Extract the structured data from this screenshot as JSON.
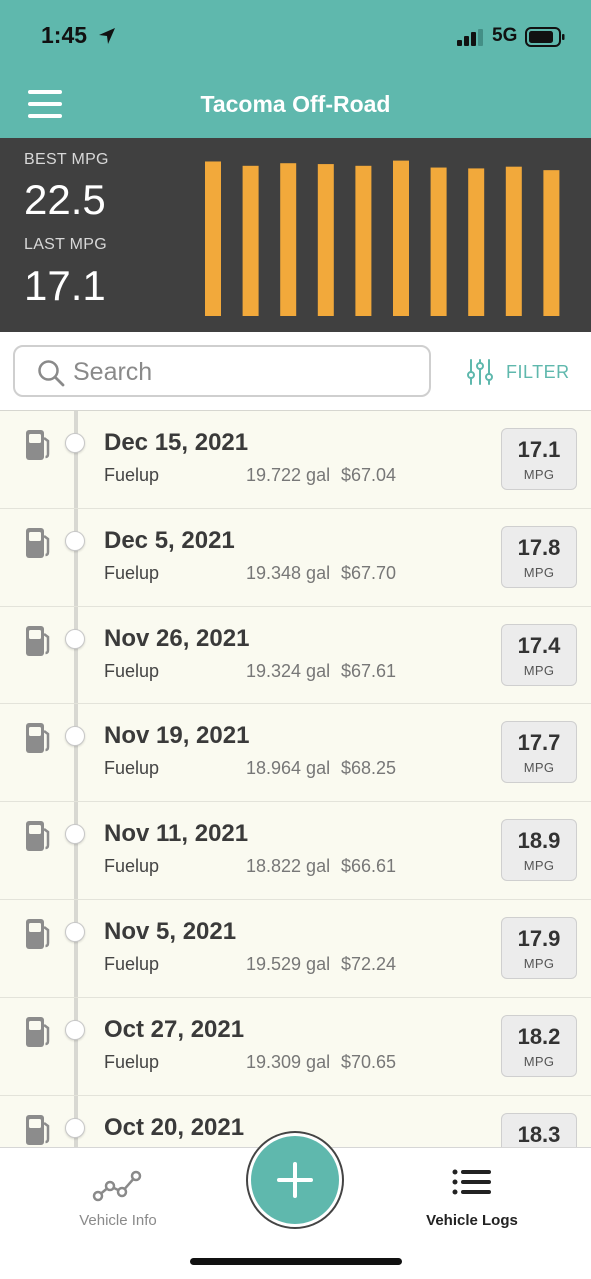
{
  "status_bar": {
    "time": "1:45",
    "network": "5G"
  },
  "header": {
    "title": "Tacoma Off-Road",
    "menu_icon": "hamburger-menu-icon"
  },
  "stats": {
    "best_label": "BEST MPG",
    "best_value": "22.5",
    "last_label": "LAST MPG",
    "last_value": "17.1",
    "bar_color": "#f2a93b"
  },
  "chart_data": {
    "type": "bar",
    "title": "",
    "values": [
      17.8,
      17.3,
      17.6,
      17.5,
      17.3,
      17.9,
      17.1,
      17.0,
      17.2,
      16.8
    ],
    "ylim": [
      0,
      18.2
    ]
  },
  "search": {
    "placeholder": "Search"
  },
  "filter": {
    "label": "FILTER"
  },
  "logs": [
    {
      "date": "Dec 15, 2021",
      "type": "Fuelup",
      "gallons": "19.722 gal",
      "cost": "$67.04",
      "mpg": "17.1",
      "unit": "MPG"
    },
    {
      "date": "Dec 5, 2021",
      "type": "Fuelup",
      "gallons": "19.348 gal",
      "cost": "$67.70",
      "mpg": "17.8",
      "unit": "MPG"
    },
    {
      "date": "Nov 26, 2021",
      "type": "Fuelup",
      "gallons": "19.324 gal",
      "cost": "$67.61",
      "mpg": "17.4",
      "unit": "MPG"
    },
    {
      "date": "Nov 19, 2021",
      "type": "Fuelup",
      "gallons": "18.964 gal",
      "cost": "$68.25",
      "mpg": "17.7",
      "unit": "MPG"
    },
    {
      "date": "Nov 11, 2021",
      "type": "Fuelup",
      "gallons": "18.822 gal",
      "cost": "$66.61",
      "mpg": "18.9",
      "unit": "MPG"
    },
    {
      "date": "Nov 5, 2021",
      "type": "Fuelup",
      "gallons": "19.529 gal",
      "cost": "$72.24",
      "mpg": "17.9",
      "unit": "MPG"
    },
    {
      "date": "Oct 27, 2021",
      "type": "Fuelup",
      "gallons": "19.309 gal",
      "cost": "$70.65",
      "mpg": "18.2",
      "unit": "MPG"
    },
    {
      "date": "Oct 20, 2021",
      "type": "",
      "gallons": "",
      "cost": "",
      "mpg": "18.3",
      "unit": ""
    }
  ],
  "tabs": {
    "vehicle_info": {
      "label": "Vehicle Info",
      "icon": "trend-line-icon"
    },
    "add": {
      "icon": "plus-icon"
    },
    "vehicle_logs": {
      "label": "Vehicle Logs",
      "icon": "list-icon"
    }
  },
  "colors": {
    "accent": "#5fb8ad",
    "stats_bg": "#404040",
    "list_bg": "#fafaf0"
  }
}
